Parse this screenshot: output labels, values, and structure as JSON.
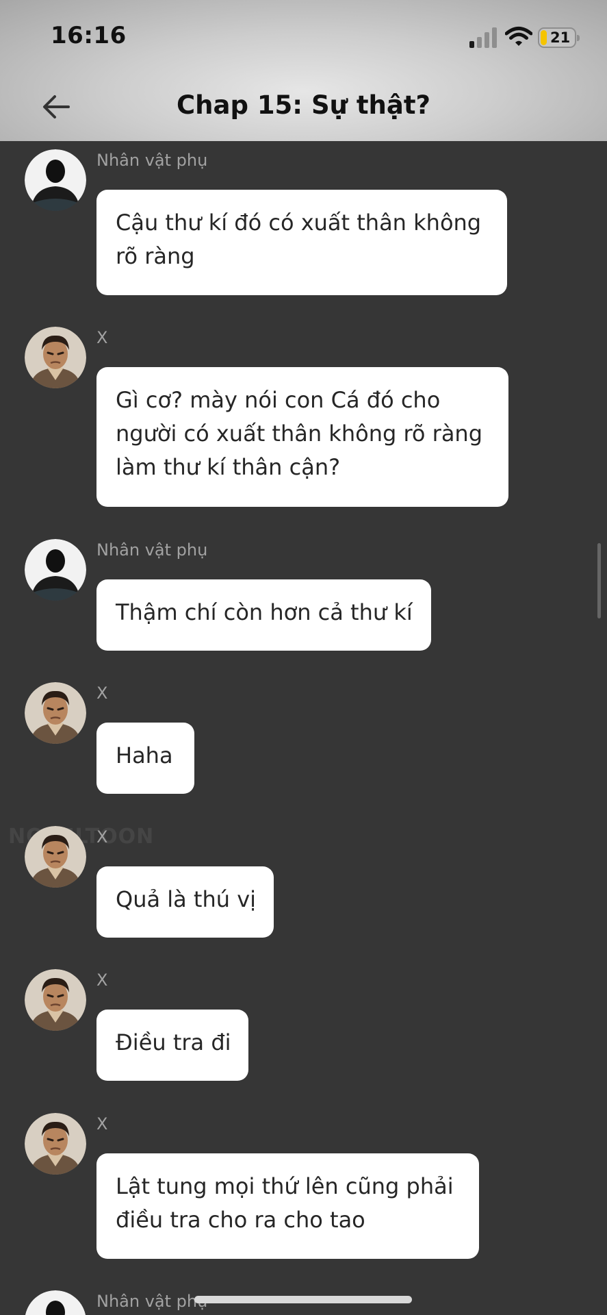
{
  "status_bar": {
    "time": "16:16",
    "battery_level": "21",
    "signal_icon": "cellular-signal-icon",
    "wifi_icon": "wifi-icon",
    "battery_icon": "battery-icon"
  },
  "header": {
    "back_icon": "back-arrow-icon",
    "title": "Chap 15: Sự thật?"
  },
  "watermark": "NOVELTOON",
  "messages": [
    {
      "sender": "Nhân vật phụ",
      "avatar": "silhouette-avatar",
      "lines": [
        "Cậu thư kí đó có xuất thân không",
        "rõ ràng"
      ]
    },
    {
      "sender": "X",
      "avatar": "man-portrait-avatar",
      "lines": [
        "Gì cơ? mày nói con Cá đó cho",
        "người có xuất thân không rõ ràng",
        "làm thư kí thân cận?"
      ]
    },
    {
      "sender": "Nhân vật phụ",
      "avatar": "silhouette-avatar",
      "lines": [
        "Thậm chí còn hơn cả thư kí"
      ]
    },
    {
      "sender": "X",
      "avatar": "man-portrait-avatar",
      "lines": [
        "Haha"
      ]
    },
    {
      "sender": "X",
      "avatar": "man-portrait-avatar",
      "lines": [
        "Quả là thú vị"
      ]
    },
    {
      "sender": "X",
      "avatar": "man-portrait-avatar",
      "lines": [
        "Điều tra đi"
      ]
    },
    {
      "sender": "X",
      "avatar": "man-portrait-avatar",
      "lines": [
        "Lật tung mọi thứ lên cũng phải",
        "điều tra cho ra cho tao"
      ]
    },
    {
      "sender": "Nhân vật phụ",
      "avatar": "silhouette-avatar",
      "lines": []
    }
  ],
  "colors": {
    "background": "#363636",
    "bubble": "#ffffff",
    "bubble_text": "#262626",
    "sender_text": "#a2a2a2",
    "battery_accent": "#f5c400"
  }
}
